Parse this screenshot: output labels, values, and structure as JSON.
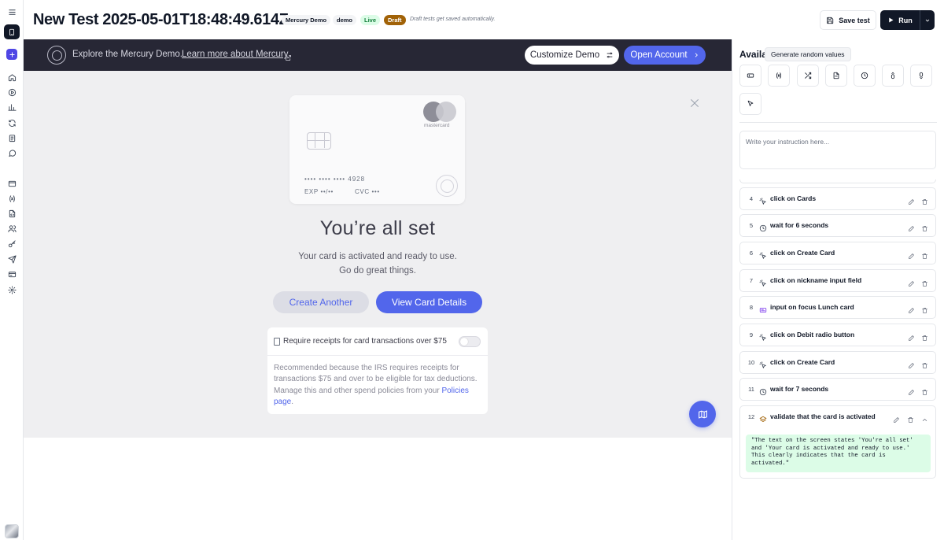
{
  "header": {
    "title": "New Test 2025-05-01T18:48:49.614Z",
    "tags": [
      "Mercury Demo",
      "demo"
    ],
    "status_live": "Live",
    "status_draft": "Draft",
    "autosave_note": "Draft tests get saved automatically.",
    "save_label": "Save test",
    "run_label": "Run"
  },
  "banner": {
    "explore_text": "Explore the Mercury Demo.",
    "learn_link": "Learn more about Mercury",
    "customize_label": "Customize Demo",
    "open_account_label": "Open Account"
  },
  "card": {
    "brand": "mastercard",
    "number": "•••• •••• •••• 4928",
    "exp": "EXP  ••/••",
    "cvc": "CVC  •••"
  },
  "success": {
    "heading": "You’re all set",
    "line1": "Your card is activated and ready to use.",
    "line2": "Go do great things.",
    "create_another_label": "Create Another",
    "view_details_label": "View Card Details"
  },
  "receipts": {
    "label": "Require receipts for card transactions over $75",
    "toggle_on": false,
    "body": "Recommended because the IRS requires receipts for transactions $75 and over to be eligible for tax deductions. Manage this and other spend policies from your ",
    "link": "Policies page",
    "link_suffix": "."
  },
  "panel": {
    "heading": "Availa",
    "tooltip": "Generate random values",
    "tools": [
      "input-box-icon",
      "variable-icon",
      "shuffle-icon",
      "file-icon",
      "clock-icon",
      "scroll-up-icon",
      "scroll-down-icon",
      "cursor-icon"
    ],
    "instruction_placeholder": "Write your instruction here...",
    "steps": [
      {
        "num": "4",
        "icon": "click-icon",
        "text": "click on Cards"
      },
      {
        "num": "5",
        "icon": "clock-icon",
        "text": "wait for 6 seconds"
      },
      {
        "num": "6",
        "icon": "click-icon",
        "text": "click on Create Card"
      },
      {
        "num": "7",
        "icon": "click-icon",
        "text": "click on nickname input field"
      },
      {
        "num": "8",
        "icon": "input-icon",
        "text": "input on focus Lunch card"
      },
      {
        "num": "9",
        "icon": "click-icon",
        "text": "click on Debit radio button"
      },
      {
        "num": "10",
        "icon": "click-icon",
        "text": "click on Create Card"
      },
      {
        "num": "11",
        "icon": "clock-icon",
        "text": "wait for 7 seconds"
      }
    ],
    "validate_step": {
      "num": "12",
      "icon": "layers-icon",
      "text": "validate that the card is activated",
      "result": "\"The text on the screen states 'You're all set'\nand 'Your card is activated and ready to use.'\nThis clearly indicates that the card is\nactivated.\""
    }
  },
  "colors": {
    "accent": "#5266eb",
    "brand_dark": "#272735",
    "live_green": "#15803d",
    "draft_brown": "#a16207",
    "run_button": "#111827",
    "success_bg": "#dcfce7"
  }
}
